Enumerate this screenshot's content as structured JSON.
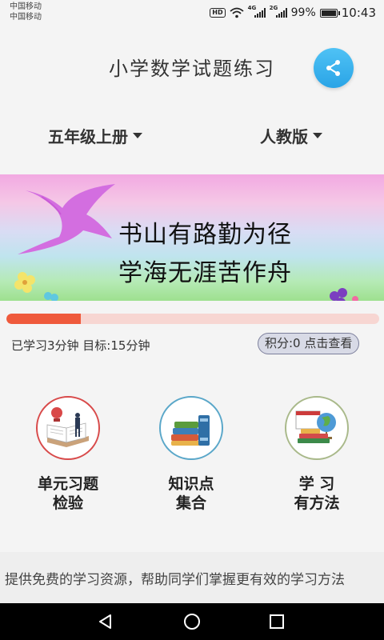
{
  "status_bar": {
    "carrier_1": "中国移动",
    "carrier_2": "中国移动",
    "hd": "HD",
    "net_1": "4G",
    "net_2": "2G",
    "battery": "99%",
    "battery_level": 0.99,
    "time": "10:43"
  },
  "header": {
    "title": "小学数学试题练习",
    "share_icon": "share-icon",
    "accent": "#2aa4e6"
  },
  "selectors": {
    "grade": "五年级上册",
    "edition": "人教版"
  },
  "banner": {
    "line_1": "书山有路勤为径",
    "line_2": "学海无涯苦作舟"
  },
  "progress": {
    "fraction": 0.2,
    "color": "#ef5a3c",
    "study_text": "已学习3分钟 目标:15分钟",
    "points_text": "积分:0 点击查看"
  },
  "menu": [
    {
      "line_1": "单元习题",
      "line_2": "检验",
      "icon": "reading-icon",
      "ring": "#d84a4a"
    },
    {
      "line_1": "知识点",
      "line_2": "集合",
      "icon": "books-icon",
      "ring": "#5aa7c9"
    },
    {
      "line_1": "学 习",
      "line_2": "有方法",
      "icon": "globe-books-icon",
      "ring": "#a9b98a"
    }
  ],
  "footer": {
    "marquee": "提供免费的学习资源，帮助同学们掌握更有效的学习方法"
  },
  "nav": {
    "back": "back-icon",
    "home": "home-icon",
    "recent": "recent-apps-icon"
  }
}
